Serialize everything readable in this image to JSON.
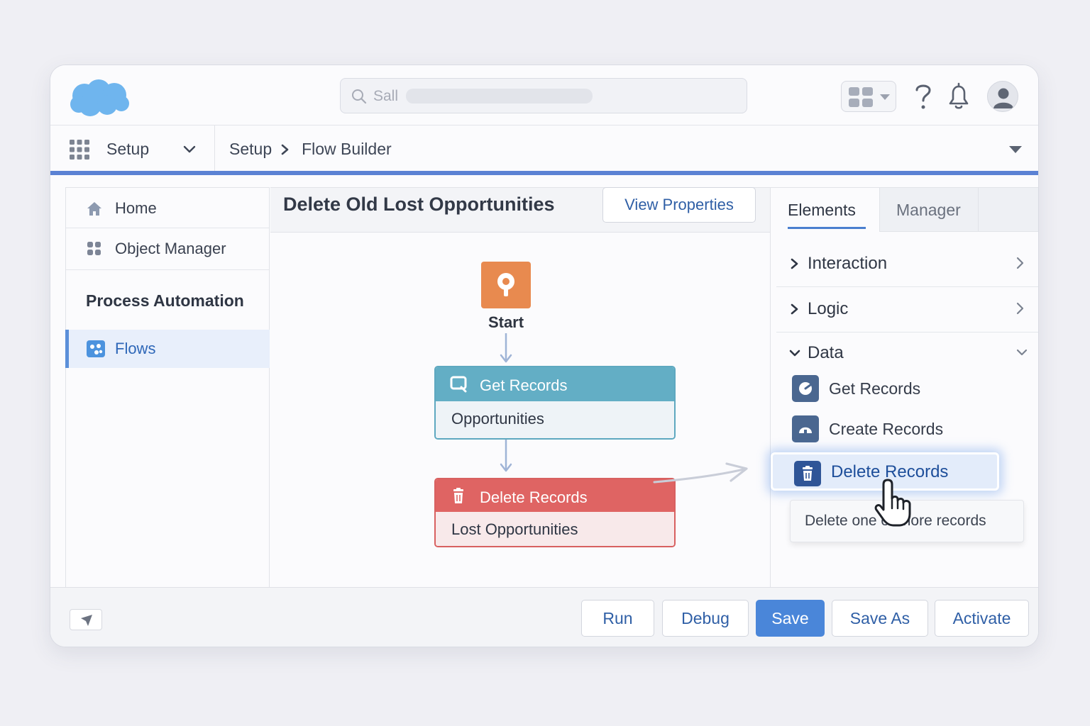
{
  "colors": {
    "brand_blue": "#5b82d4",
    "start_orange": "#e88a4f",
    "get_records_teal": "#63aec5",
    "delete_records_red": "#df6463",
    "primary_button": "#4a86d9"
  },
  "header": {
    "logo_icon": "cloud-logo",
    "search": {
      "placeholder": "Sall",
      "icon": "search-icon"
    },
    "icons": [
      "app-grid-icon",
      "help-icon",
      "bell-icon",
      "user-avatar-icon"
    ]
  },
  "appbar": {
    "app_name": "Setup",
    "breadcrumb": [
      "Setup",
      "Flow Builder"
    ]
  },
  "sidebar": {
    "items": [
      {
        "label": "Home",
        "icon": "home-icon"
      },
      {
        "label": "Object Manager",
        "icon": "grid-icon"
      }
    ],
    "section_title": "Process Automation",
    "selected": {
      "label": "Flows",
      "icon": "flows-icon"
    }
  },
  "canvas": {
    "title": "Delete Old Lost Opportunities",
    "view_properties": "View Properties",
    "start_label": "Start",
    "nodes": [
      {
        "type": "Get Records",
        "object": "Opportunities",
        "icon": "get-records-icon"
      },
      {
        "type": "Delete Records",
        "object": "Lost Opportunities",
        "icon": "trash-icon"
      }
    ]
  },
  "rpanel": {
    "tabs": [
      "Elements",
      "Manager"
    ],
    "categories": [
      {
        "label": "Interaction",
        "expanded": false
      },
      {
        "label": "Logic",
        "expanded": false
      },
      {
        "label": "Data",
        "expanded": true
      }
    ],
    "data_items": [
      {
        "label": "Get Records",
        "icon": "get-records-icon"
      },
      {
        "label": "Create Records",
        "icon": "create-records-icon"
      },
      {
        "label": "Delete Records",
        "icon": "trash-icon",
        "highlighted": true
      }
    ],
    "tooltip": "Delete one or more records"
  },
  "footer": {
    "buttons": [
      "Run",
      "Debug",
      "Save",
      "Save As",
      "Activate"
    ]
  }
}
